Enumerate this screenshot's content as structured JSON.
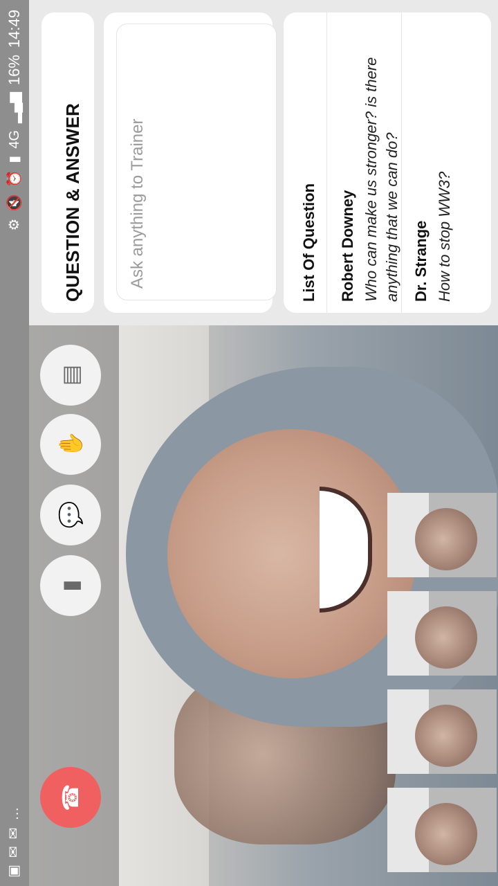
{
  "status_bar": {
    "left_icons": [
      "image-icon",
      "mail-icon",
      "mail-icon",
      "more-icon"
    ],
    "right_icons": [
      "settings-icon",
      "mute-icon",
      "alarm-icon",
      "sim-icon",
      "network-4g-icon",
      "signal-icon"
    ],
    "battery": "16%",
    "time": "14:49"
  },
  "controls": {
    "buttons": [
      "end-call-icon",
      "phone-icon",
      "chat-icon",
      "raise-hand-icon",
      "screen-share-icon"
    ]
  },
  "qa": {
    "title": "QUESTION & ANSWER",
    "ask_placeholder": "Ask anything to Trainer",
    "list_header": "List Of Question",
    "questions": [
      {
        "name": "Robert Downey",
        "text": "Who can make us stronger? is there anything that we can do?"
      },
      {
        "name": "Dr. Strange",
        "text": "How to stop WW3?"
      }
    ]
  },
  "colors": {
    "end_call": "#f06060",
    "status_bar": "#8e8e8e",
    "panel_bg": "#e9e9e9"
  }
}
